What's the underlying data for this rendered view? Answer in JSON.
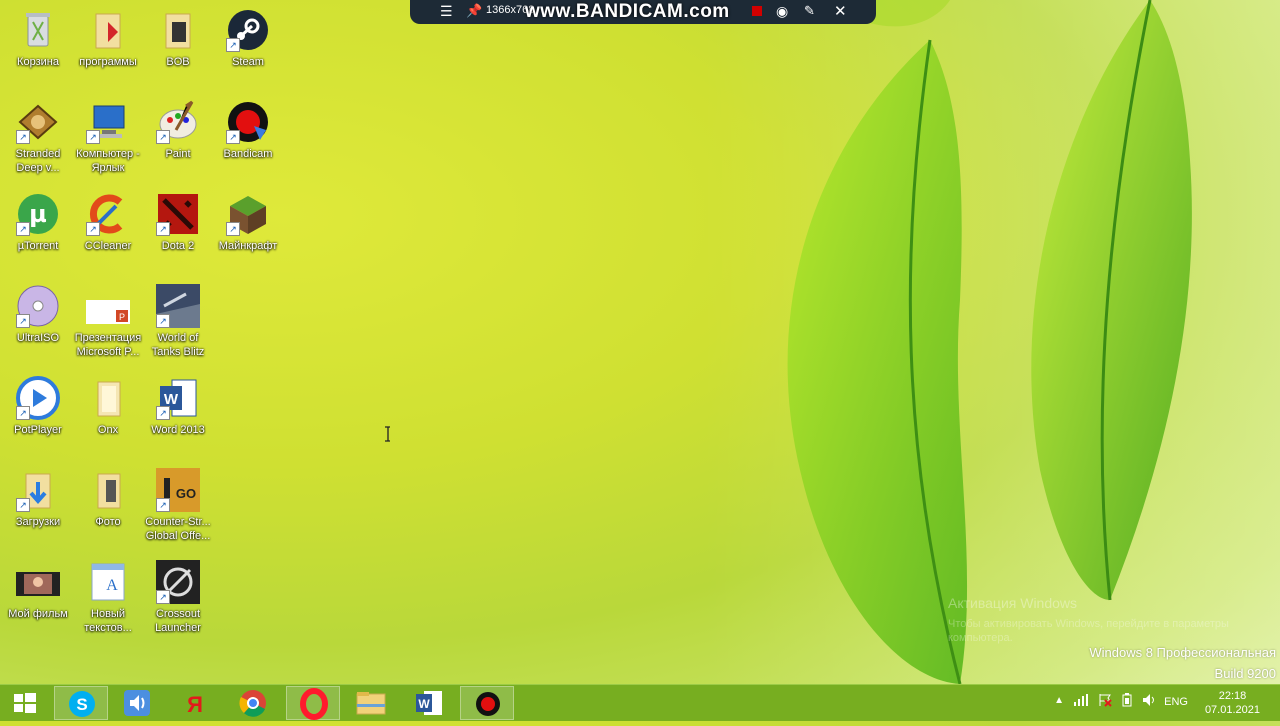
{
  "bandicam": {
    "resolution": "1366x768",
    "watermark": "www.BANDICAM.com"
  },
  "desktop_icons": [
    {
      "label": "Корзина"
    },
    {
      "label": "программы"
    },
    {
      "label": "BOB"
    },
    {
      "label": "Steam"
    },
    {
      "label": "Stranded Deep v..."
    },
    {
      "label": "Компьютер - Ярлык"
    },
    {
      "label": "Paint"
    },
    {
      "label": "Bandicam"
    },
    {
      "label": "µTorrent"
    },
    {
      "label": "CCleaner"
    },
    {
      "label": "Dota 2"
    },
    {
      "label": "Майнкрафт"
    },
    {
      "label": "UltraISO"
    },
    {
      "label": "Презентация Microsoft P..."
    },
    {
      "label": "World of Tanks Blitz"
    },
    {
      "label": "PotPlayer"
    },
    {
      "label": "Onx"
    },
    {
      "label": "Word 2013"
    },
    {
      "label": "Загрузки"
    },
    {
      "label": "Фото"
    },
    {
      "label": "Counter-Str... Global Offe..."
    },
    {
      "label": "Мой фильм"
    },
    {
      "label": "Новый текстов..."
    },
    {
      "label": "Crossout Launcher"
    }
  ],
  "watermark": {
    "activation_title": "Активация Windows",
    "activation_text": "Чтобы активировать Windows, перейдите в параметры компьютера.",
    "edition": "Windows 8 Профессиональная",
    "build": "Build 9200"
  },
  "taskbar": {
    "items": [
      "start",
      "skype",
      "sound",
      "yandex",
      "chrome",
      "opera",
      "explorer",
      "word",
      "bandicam"
    ],
    "language": "ENG",
    "time": "22:18",
    "date": "07.01.2021"
  },
  "colors": {
    "taskbar": "#77ae20",
    "accent": "#d20000"
  }
}
